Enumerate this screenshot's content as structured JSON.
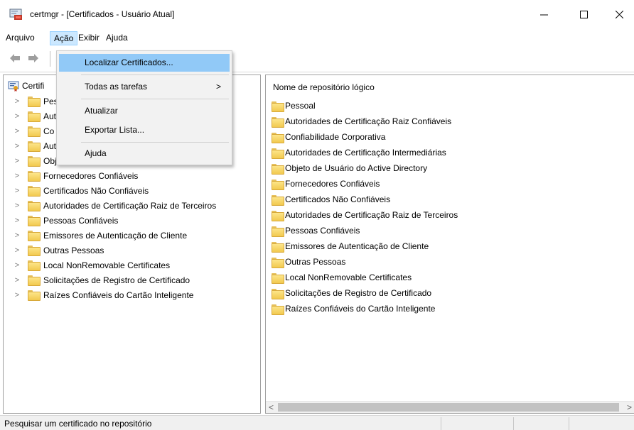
{
  "window": {
    "title": "certmgr - [Certificados - Usuário Atual]",
    "icons": {
      "app": "certificate-app-icon",
      "minimize": "minimize-icon",
      "maximize": "maximize-icon",
      "close": "close-icon"
    }
  },
  "menubar": {
    "items": [
      "Arquivo",
      "Ação",
      "Exibir",
      "Ajuda"
    ],
    "active_index": 1
  },
  "toolbar": {
    "icons": [
      "back-arrow-icon",
      "forward-arrow-icon"
    ]
  },
  "action_menu": {
    "items": [
      {
        "label": "Localizar Certificados...",
        "highlighted": true
      },
      {
        "label": "Todas as tarefas",
        "submenu": true,
        "arrow": ">"
      },
      {
        "label": "Atualizar"
      },
      {
        "label": "Exportar Lista..."
      },
      {
        "label": "Ajuda"
      }
    ]
  },
  "tree": {
    "root_label": "Certifi",
    "items": [
      {
        "label": "Pes"
      },
      {
        "label": "Aut"
      },
      {
        "label": "Co"
      },
      {
        "label": "Aut"
      },
      {
        "label": "Obj"
      },
      {
        "label": "Fornecedores Confiáveis"
      },
      {
        "label": "Certificados Não Confiáveis"
      },
      {
        "label": "Autoridades de Certificação Raiz de Terceiros"
      },
      {
        "label": "Pessoas Confiáveis"
      },
      {
        "label": "Emissores de Autenticação de Cliente"
      },
      {
        "label": "Outras Pessoas"
      },
      {
        "label": "Local NonRemovable Certificates"
      },
      {
        "label": "Solicitações de Registro de Certificado"
      },
      {
        "label": "Raízes Confiáveis do Cartão Inteligente"
      }
    ]
  },
  "list": {
    "header": "Nome de repositório lógico",
    "items": [
      "Pessoal",
      "Autoridades de Certificação Raiz Confiáveis",
      "Confiabilidade Corporativa",
      "Autoridades de Certificação Intermediárias",
      "Objeto de Usuário do Active Directory",
      "Fornecedores Confiáveis",
      "Certificados Não Confiáveis",
      "Autoridades de Certificação Raiz de Terceiros",
      "Pessoas Confiáveis",
      "Emissores de Autenticação de Cliente",
      "Outras Pessoas",
      "Local NonRemovable Certificates",
      "Solicitações de Registro de Certificado",
      "Raízes Confiáveis do Cartão Inteligente"
    ]
  },
  "scrollbar": {
    "left_arrow": "<",
    "right_arrow": ">"
  },
  "status": {
    "text": "Pesquisar um certificado no repositório"
  },
  "colors": {
    "menu_active_bg": "#cce8ff",
    "menu_highlight_bg": "#91c9f7",
    "folder": "#f2c94f",
    "statusbar_bg": "#f0f0f0"
  }
}
